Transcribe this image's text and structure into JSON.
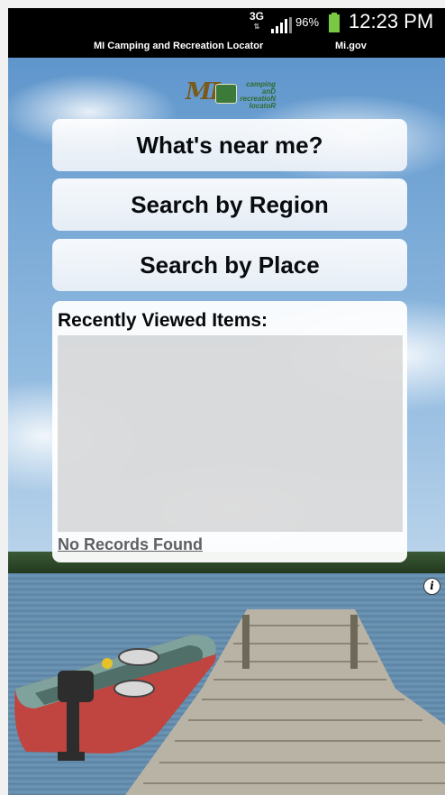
{
  "status_bar": {
    "network": "3G",
    "battery_percent": "96%",
    "time": "12:23 PM"
  },
  "title_bar": {
    "app_name": "MI Camping and Recreation Locator",
    "site": "Mi.gov"
  },
  "logo": {
    "mi_text": "MI",
    "line1": "camping anD",
    "line2": "recreatioN",
    "line3": "locatoR"
  },
  "buttons": {
    "near_me": "What's near me?",
    "by_region": "Search by Region",
    "by_place": "Search by Place"
  },
  "recent": {
    "title": "Recently Viewed Items:",
    "empty_text": "No Records Found"
  },
  "info_icon": "i",
  "colors": {
    "status_bar_bg": "#000000",
    "battery": "#7ac943",
    "list_bg": "#dcdcdc"
  }
}
